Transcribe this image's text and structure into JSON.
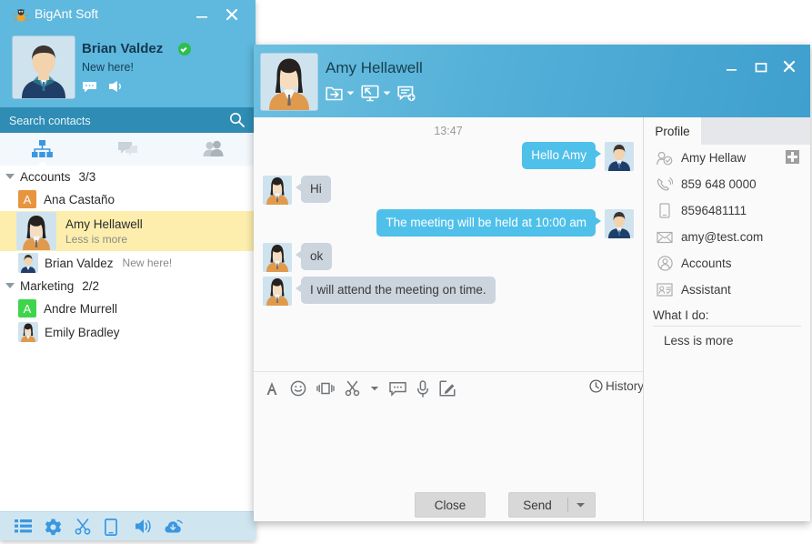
{
  "main_window": {
    "title": "BigAnt Soft",
    "logo_icon": "ant-logo-icon",
    "minimize_label": "minimize-icon",
    "close_label": "close-icon",
    "profile": {
      "name": "Brian Valdez",
      "signature": "New here!",
      "status": "online",
      "avatar": "male-avatar",
      "icons": [
        "speech-bubble-icon",
        "megaphone-icon"
      ]
    },
    "search": {
      "placeholder": "Search contacts",
      "value": "",
      "icon": "search-icon"
    },
    "tabs": [
      {
        "name": "organization",
        "icon": "org-tree-icon",
        "active": true
      },
      {
        "name": "conversations",
        "icon": "chat-bubbles-icon",
        "active": false
      },
      {
        "name": "contacts",
        "icon": "people-icon",
        "active": false
      }
    ],
    "groups": [
      {
        "name": "Accounts",
        "count": "3/3",
        "items": [
          {
            "name": "Ana Castaño",
            "avatar_type": "letter",
            "letter": "A",
            "color": "#e8953f",
            "message": ""
          },
          {
            "name": "Amy Hellawell",
            "avatar_type": "photo-female",
            "message": "Less is more",
            "selected": true
          },
          {
            "name": "Brian Valdez",
            "avatar_type": "photo-male",
            "message": "New here!"
          }
        ]
      },
      {
        "name": "Marketing",
        "count": "2/2",
        "items": [
          {
            "name": "Andre Murrell",
            "avatar_type": "letter",
            "letter": "A",
            "color": "#3ed44c",
            "message": ""
          },
          {
            "name": "Emily Bradley",
            "avatar_type": "photo-female",
            "message": ""
          }
        ]
      }
    ],
    "bottom_bar_icons": [
      "list-icon",
      "settings-gear-icon",
      "scissors-icon",
      "mobile-icon",
      "speaker-icon",
      "cloud-download-icon"
    ]
  },
  "chat_window": {
    "contact_name": "Amy Hellawell",
    "avatar": "female-avatar",
    "header_tools": [
      {
        "name": "send-file-icon",
        "has_dropdown": true
      },
      {
        "name": "remote-desktop-icon",
        "has_dropdown": true
      },
      {
        "name": "add-note-icon",
        "has_dropdown": false
      }
    ],
    "window_controls": [
      "minimize-icon",
      "maximize-icon",
      "close-icon"
    ],
    "conversation": {
      "timestamp": "13:47",
      "messages": [
        {
          "text": "Hello Amy",
          "side": "out",
          "sender": "Brian Valdez"
        },
        {
          "text": "Hi",
          "side": "in",
          "sender": "Amy Hellawell"
        },
        {
          "text": "The meeting will be held at 10:00 am",
          "side": "out",
          "sender": "Brian Valdez"
        },
        {
          "text": "ok",
          "side": "in",
          "sender": "Amy Hellawell"
        },
        {
          "text": "I will attend the meeting on time.",
          "side": "in",
          "sender": "Amy Hellawell"
        }
      ]
    },
    "compose_toolbar": {
      "icons": [
        "font-format-icon",
        "emoji-icon",
        "shake-window-icon",
        "screenshot-scissors-icon",
        "screenshot-dropdown-icon",
        "quick-reply-icon",
        "voice-message-icon",
        "handwriting-icon"
      ],
      "history_label": "History",
      "history_icon": "clock-icon"
    },
    "input": {
      "value": "",
      "placeholder": ""
    },
    "buttons": {
      "close_label": "Close",
      "send_label": "Send",
      "send_dropdown_icon": "chevron-down-icon"
    },
    "profile_panel": {
      "tab_label": "Profile",
      "rows": [
        {
          "icon": "user-check-icon",
          "value": "Amy Hellaw",
          "has_add": true
        },
        {
          "icon": "phone-icon",
          "value": "859 648 0000",
          "has_add": false
        },
        {
          "icon": "mobile-phone-icon",
          "value": "8596481111",
          "has_add": false
        },
        {
          "icon": "envelope-icon",
          "value": "amy@test.com",
          "has_add": false
        },
        {
          "icon": "department-icon",
          "value": "Accounts",
          "has_add": false
        },
        {
          "icon": "id-card-icon",
          "value": "Assistant",
          "has_add": false
        }
      ],
      "what_i_do_label": "What I do:",
      "what_i_do_value": "Less is more"
    }
  },
  "colors": {
    "main_accent": "#5fb8dd",
    "search_bar": "#2f8cb4",
    "header_gradient_start": "#6cc0e0",
    "header_gradient_end": "#3f9fcd",
    "outgoing_bubble": "#4fc0ea",
    "incoming_bubble": "#ccd4de",
    "selected_row": "#fdeead",
    "online_status": "#2dbe4e",
    "tab_active_icon": "#3a97e0"
  }
}
